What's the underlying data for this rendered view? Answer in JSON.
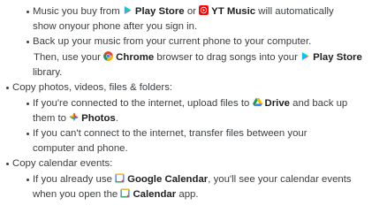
{
  "sections": {
    "music": {
      "l1_pre": "Music you buy from ",
      "play_store": "Play Store",
      "l1_or": " or ",
      "yt_music": "YT Music",
      "l1_post": " will automatically",
      "l2": "show onyour phone after you sign in.",
      "l3": "Back up your music from your current phone to your computer.",
      "l4_pre": "Then, use your ",
      "chrome": "Chrome",
      "l4_post": " browser to drag songs into your ",
      "play_store_2": "Play Store",
      "l5": "library."
    },
    "photos": {
      "heading": "Copy photos, videos, files & folders:",
      "l1_pre": "If you're connected to the internet, upload files to ",
      "drive": "Drive",
      "l1_post": " and back up",
      "l2_pre": "them to ",
      "photos_app": "Photos",
      "l2_post": ".",
      "l3": "If you can't connect to the internet, transfer files between your",
      "l4": "computer and phone."
    },
    "calendar": {
      "heading": "Copy calendar events:",
      "l1_pre": "If you already use ",
      "google_calendar": "Google Calendar",
      "l1_post": ", you'll see your calendar events",
      "l2_pre": "when you open the ",
      "calendar_app": "Calendar",
      "l2_post": " app."
    }
  },
  "icons": {
    "play_store": "play-store-icon",
    "yt_music": "yt-music-icon",
    "chrome": "chrome-icon",
    "drive": "drive-icon",
    "photos": "photos-icon",
    "calendar": "calendar-icon"
  }
}
